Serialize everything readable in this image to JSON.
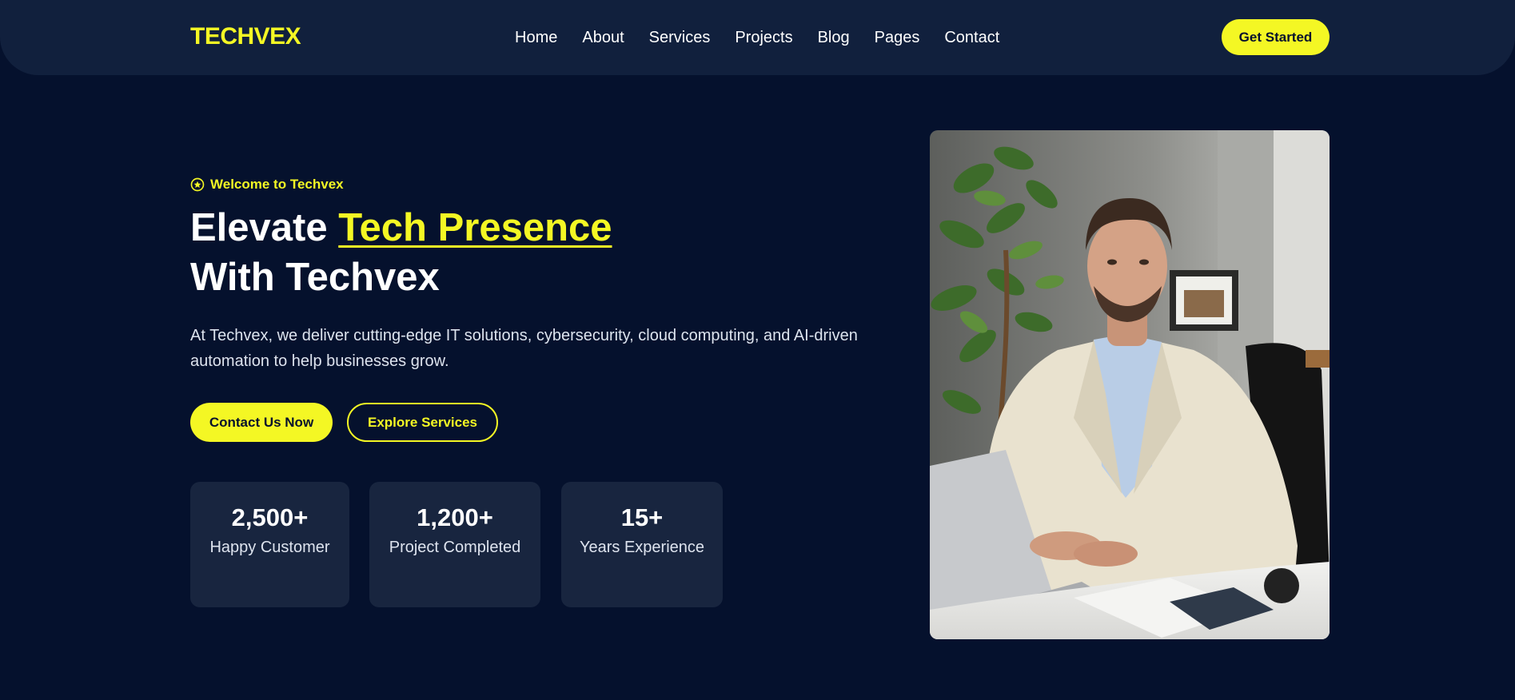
{
  "header": {
    "logo": "TECHVEX",
    "nav": [
      "Home",
      "About",
      "Services",
      "Projects",
      "Blog",
      "Pages",
      "Contact"
    ],
    "cta": "Get Started"
  },
  "hero": {
    "tagline": "Welcome to Techvex",
    "title_part1": "Elevate ",
    "title_highlight": "Tech Presence",
    "title_line2": "With Techvex",
    "description": "At Techvex, we deliver cutting-edge IT solutions, cybersecurity, cloud computing, and AI-driven automation to help businesses grow.",
    "primary_button": "Contact Us Now",
    "secondary_button": "Explore Services"
  },
  "stats": [
    {
      "value": "2,500+",
      "label": "Happy Customer"
    },
    {
      "value": "1,200+",
      "label": "Project Completed"
    },
    {
      "value": "15+",
      "label": "Years Experience"
    }
  ],
  "colors": {
    "background": "#05112d",
    "header": "#11203d",
    "accent": "#f4f724",
    "card": "#18253f"
  },
  "icons": {
    "tagline": "star-badge-icon"
  }
}
